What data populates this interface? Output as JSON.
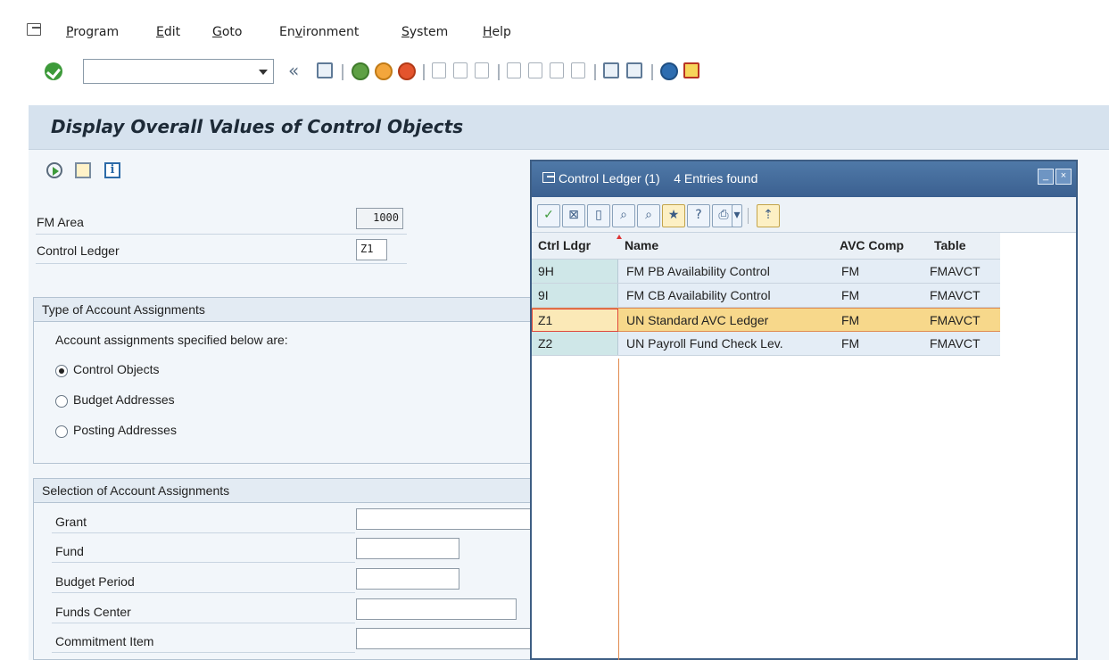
{
  "menu": {
    "items": [
      {
        "pre": "",
        "acc": "P",
        "post": "rogram"
      },
      {
        "pre": "",
        "acc": "E",
        "post": "dit"
      },
      {
        "pre": "",
        "acc": "G",
        "post": "oto"
      },
      {
        "pre": "En",
        "acc": "v",
        "post": "ironment"
      },
      {
        "pre": "",
        "acc": "S",
        "post": "ystem"
      },
      {
        "pre": "",
        "acc": "H",
        "post": "elp"
      }
    ]
  },
  "toolbar": {
    "command_value": "",
    "back_glyph": "«"
  },
  "screen": {
    "title": "Display Overall Values of Control Objects"
  },
  "header_fields": {
    "fm_area_label": "FM Area",
    "fm_area_value": "1000",
    "control_ledger_label": "Control Ledger",
    "control_ledger_value": "Z1"
  },
  "type_group": {
    "title": "Type of Account Assignments",
    "intro": "Account assignments specified below are:",
    "options": [
      "Control Objects",
      "Budget Addresses",
      "Posting Addresses"
    ],
    "selected": "Control Objects"
  },
  "selection_group": {
    "title": "Selection of Account Assignments",
    "fields": [
      "Grant",
      "Fund",
      "Budget Period",
      "Funds Center",
      "Commitment Item"
    ]
  },
  "dialog": {
    "title": "Control Ledger (1)",
    "entries_found": "4 Entries found",
    "columns": [
      "Ctrl Ldgr",
      "Name",
      "AVC Comp",
      "Table"
    ],
    "rows": [
      {
        "ldgr": "9H",
        "name": "FM PB Availability Control",
        "comp": "FM",
        "table": "FMAVCT"
      },
      {
        "ldgr": "9I",
        "name": "FM CB Availability Control",
        "comp": "FM",
        "table": "FMAVCT"
      },
      {
        "ldgr": "Z1",
        "name": "UN Standard AVC Ledger",
        "comp": "FM",
        "table": "FMAVCT"
      },
      {
        "ldgr": "Z2",
        "name": "UN Payroll Fund Check Lev.",
        "comp": "FM",
        "table": "FMAVCT"
      }
    ],
    "selected_row": "Z1"
  },
  "colors": {
    "title_bar": "#d6e2ee",
    "dialog_header": "#3b6090",
    "selection": "#f7d88b",
    "key_cell": "#cfe7e8"
  },
  "icons": {
    "menu": "window-menu-icon",
    "enter": "check-circle-icon",
    "save": "save-icon",
    "back": "back-icon",
    "exit": "exit-icon",
    "cancel": "cancel-icon",
    "print": "print-icon",
    "find": "find-icon",
    "help": "help-icon"
  }
}
